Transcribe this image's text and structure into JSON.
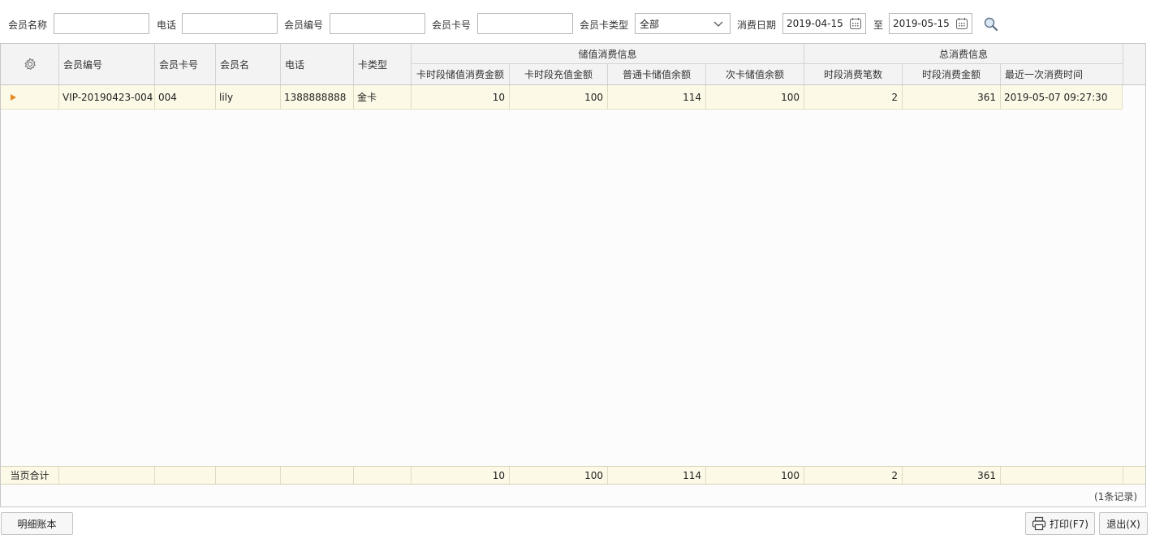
{
  "filters": {
    "member_name_label": "会员名称",
    "member_name_value": "",
    "phone_label": "电话",
    "phone_value": "",
    "member_no_label": "会员编号",
    "member_no_value": "",
    "card_no_label": "会员卡号",
    "card_no_value": "",
    "card_type_label": "会员卡类型",
    "card_type_value": "全部",
    "date_label": "消费日期",
    "date_from": "2019-04-15",
    "date_to_label": "至",
    "date_to": "2019-05-15"
  },
  "grid": {
    "headers": {
      "member_no": "会员编号",
      "card_no": "会员卡号",
      "member_name": "会员名",
      "phone": "电话",
      "card_type": "卡类型",
      "stored_group": "储值消费信息",
      "stored_consume": "卡时段储值消费金额",
      "recharge": "卡时段充值金额",
      "normal_balance": "普通卡储值余额",
      "times_balance": "次卡储值余额",
      "total_group": "总消费信息",
      "consume_count": "时段消费笔数",
      "consume_amount": "时段消费金额",
      "last_consume_time": "最近一次消费时间"
    },
    "rows": [
      {
        "member_no": "VIP-20190423-004",
        "card_no": "004",
        "member_name": "lily",
        "phone": "1388888888",
        "card_type": "金卡",
        "stored_consume": "10",
        "recharge": "100",
        "normal_balance": "114",
        "times_balance": "100",
        "consume_count": "2",
        "consume_amount": "361",
        "last_consume_time": "2019-05-07 09:27:30"
      }
    ],
    "totals": {
      "label": "当页合计",
      "stored_consume": "10",
      "recharge": "100",
      "normal_balance": "114",
      "times_balance": "100",
      "consume_count": "2",
      "consume_amount": "361"
    },
    "record_count": "(1条记录)"
  },
  "footer": {
    "detail_button": "明细账本",
    "print_button": "打印(F7)",
    "exit_button": "退出(X)"
  },
  "colors": {
    "row_highlight": "#fcf9e6",
    "indicator": "#e58a1f",
    "header_bg": "#f3f3f3"
  },
  "icons": [
    "calendar-icon",
    "chevron-down-icon",
    "search-icon",
    "gear-icon",
    "printer-icon",
    "row-indicator-icon"
  ]
}
